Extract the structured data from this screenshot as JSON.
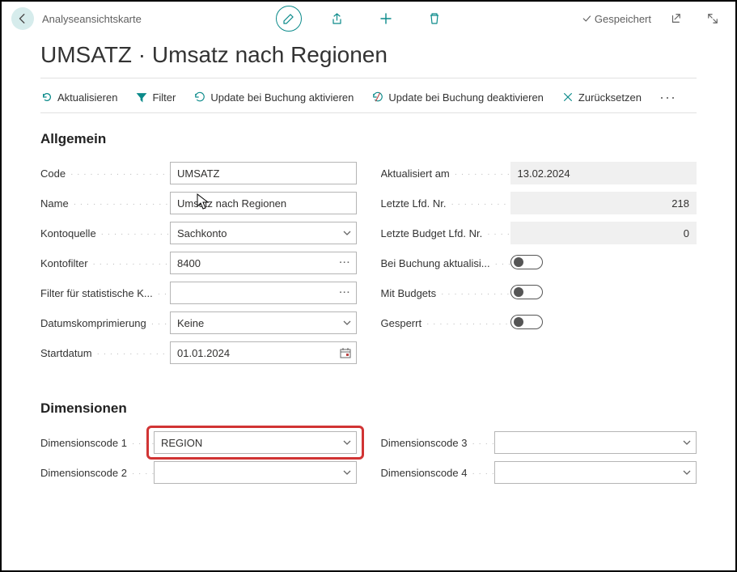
{
  "header": {
    "breadcrumb": "Analyseansichtskarte",
    "saved_label": "Gespeichert"
  },
  "title": "UMSATZ · Umsatz nach Regionen",
  "actions": {
    "refresh": "Aktualisieren",
    "filter": "Filter",
    "update_on_post_enable": "Update bei Buchung aktivieren",
    "update_on_post_disable": "Update bei Buchung deaktivieren",
    "reset": "Zurücksetzen"
  },
  "general": {
    "section_title": "Allgemein",
    "left": {
      "code_label": "Code",
      "code_value": "UMSATZ",
      "name_label": "Name",
      "name_value": "Umsatz nach Regionen",
      "accsource_label": "Kontoquelle",
      "accsource_value": "Sachkonto",
      "accfilter_label": "Kontofilter",
      "accfilter_value": "8400",
      "statfilter_label": "Filter für statistische K...",
      "statfilter_value": "",
      "datecomp_label": "Datumskomprimierung",
      "datecomp_value": "Keine",
      "startdate_label": "Startdatum",
      "startdate_value": "01.01.2024"
    },
    "right": {
      "updated_label": "Aktualisiert am",
      "updated_value": "13.02.2024",
      "lastentry_label": "Letzte Lfd. Nr.",
      "lastentry_value": "218",
      "lastbudget_label": "Letzte Budget Lfd. Nr.",
      "lastbudget_value": "0",
      "upd_on_posting_label": "Bei Buchung aktualisi...",
      "with_budgets_label": "Mit Budgets",
      "blocked_label": "Gesperrt"
    }
  },
  "dimensions": {
    "section_title": "Dimensionen",
    "dim1_label": "Dimensionscode 1",
    "dim1_value": "REGION",
    "dim2_label": "Dimensionscode 2",
    "dim2_value": "",
    "dim3_label": "Dimensionscode 3",
    "dim3_value": "",
    "dim4_label": "Dimensionscode 4",
    "dim4_value": ""
  }
}
